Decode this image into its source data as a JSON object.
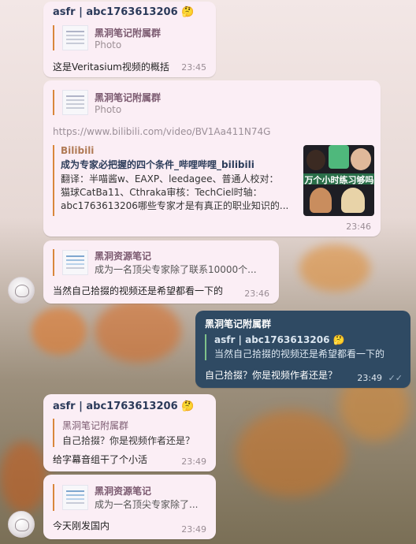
{
  "colors": {
    "bubble_in": "#fbeef5",
    "bubble_out": "#2f4a63",
    "reply_bar": "#d9873b",
    "sender": "#2b3a5a"
  },
  "messages": [
    {
      "sender": "asfr | abc1763613206",
      "sender_emoji": "🤔",
      "reply_title": "黑洞笔记附属群",
      "reply_sub": "Photo",
      "text": "这是Veritasium视频的概括",
      "time": "23:45"
    },
    {
      "reply_title": "黑洞笔记附属群",
      "reply_sub": "Photo",
      "url": "https://www.bilibili.com/video/BV1Aa411N74G",
      "preview_site": "Bilibili",
      "preview_title": "成为专家必把握的四个条件_哔哩哔哩_bilibili",
      "preview_desc_1": "翻译：半喵酱w、EAXP、leedagee、普通人校对：",
      "preview_desc_2": "猫球CatBa11、Cthraka审核：TechCiel时轴：",
      "preview_desc_3": "abc1763613206哪些专家才是有真正的职业知识的...",
      "thumb_text": "万个小时练习够吗",
      "time": "23:46"
    },
    {
      "reply_title": "黑洞资源笔记",
      "reply_sub": "成为一名顶尖专家除了联系10000个...",
      "text": "当然自己拾掇的视频还是希望都看一下的",
      "time": "23:46"
    },
    {
      "header": "黑洞笔记附属群",
      "reply_title": "asfr | abc1763613206",
      "reply_emoji": "🤔",
      "reply_sub": "当然自己拾掇的视频还是希望都看一下的",
      "text": "自己拾掇？你是视频作者还是？",
      "time": "23:49",
      "check": "✓✓"
    },
    {
      "sender": "asfr | abc1763613206",
      "sender_emoji": "🤔",
      "reply_title": "黑洞笔记附属群",
      "reply_sub": "自己拾掇？你是视频作者还是？",
      "text": "给字幕音组干了个小活",
      "time": "23:49"
    },
    {
      "reply_title": "黑洞资源笔记",
      "reply_sub": "成为一名顶尖专家除了...",
      "text": "今天刚发国内",
      "time": "23:49"
    }
  ]
}
